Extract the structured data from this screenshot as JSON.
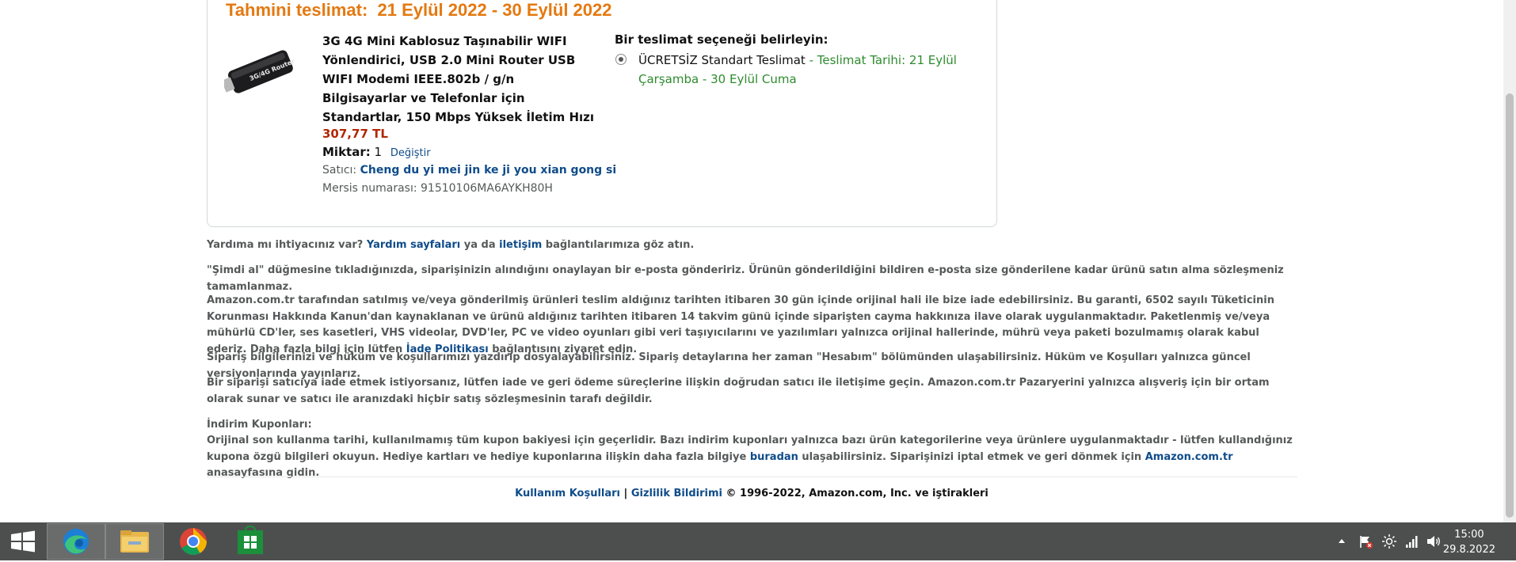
{
  "delivery": {
    "estimate": "Tahmini teslimat:  21 Eylül 2022 - 30 Eylül 2022"
  },
  "product": {
    "image_text": "3G/4G Router",
    "title": "3G 4G Mini Kablosuz Taşınabilir WIFI Yönlendirici, USB 2.0 Mini Router USB WIFI Modemi IEEE.802b / g/n Bilgisayarlar ve Telefonlar için Standartlar, 150 Mbps Yüksek İletim Hızı",
    "price": "307,77 TL",
    "quantity_label": "Miktar:",
    "quantity_value": "1",
    "change_link": "Değiştir",
    "seller_label": "Satıcı:",
    "seller_name": "Cheng du yi mei jin ke ji you xian gong si",
    "mersis": "Mersis numarası: 91510106MA6AYKH80H"
  },
  "shipping_option": {
    "heading": "Bir teslimat seçeneği belirleyin:",
    "option_label": "ÜCRETSİZ Standart Teslimat",
    "option_dates": " - Teslimat Tarihi: 21 Eylül Çarşamba - 30 Eylül Cuma",
    "selected": true
  },
  "info": {
    "help_prefix": "Yardıma mı ihtiyacınız var? ",
    "help_link1": "Yardım sayfaları",
    "help_mid": " ya da ",
    "help_link2": "iletişim",
    "help_suffix": " bağlantılarımıza göz atın.",
    "buy_now": "\"Şimdi al\" düğmesine tıkladığınızda, siparişinizin alındığını onaylayan bir e-posta göndeririz. Ürünün gönderildiğini bildiren e-posta size gönderilene kadar ürünü satın alma sözleşmeniz tamamlanmaz.",
    "returns_text": "Amazon.com.tr tarafından satılmış ve/veya gönderilmiş ürünleri teslim aldığınız tarihten itibaren 30 gün içinde orijinal hali ile bize iade edebilirsiniz. Bu garanti, 6502 sayılı Tüketicinin Korunması Hakkında Kanun'dan kaynaklanan ve ürünü aldığınız tarihten itibaren 14 takvim günü içinde siparişten cayma hakkınıza ilave olarak uygulanmaktadır. Paketlenmiş ve/veya mühürlü CD'ler, ses kasetleri, VHS videolar, DVD'ler, PC ve video oyunları gibi veri taşıyıcılarını ve yazılımları yalnızca orijinal hallerinde, mührü veya paketi bozulmamış olarak kabul ederiz. Daha fazla bilgi için lütfen ",
    "returns_link": "İade Politikası",
    "returns_suffix": " bağlantısını ziyaret edin.",
    "print_info": "Sipariş bilgilerinizi ve hüküm ve koşullarımızı yazdırıp dosyalayabilirsiniz. Sipariş detaylarına her zaman \"Hesabım\" bölümünden ulaşabilirsiniz. Hüküm ve Koşulları yalnızca güncel versiyonlarında yayınlarız.",
    "seller_return": "Bir siparişi satıcıya iade etmek istiyorsanız, lütfen iade ve geri ödeme süreçlerine ilişkin doğrudan satıcı ile iletişime geçin. Amazon.com.tr Pazaryerini yalnızca alışveriş için bir ortam olarak sunar ve satıcı ile aranızdaki hiçbir satış sözleşmesinin tarafı değildir.",
    "coupons_heading": "İndirim Kuponları:",
    "coupons_text": "Orijinal son kullanma tarihi, kullanılmamış tüm kupon bakiyesi için geçerlidir. Bazı indirim kuponları yalnızca bazı ürün kategorilerine veya ürünlere uygulanmaktadır - lütfen kullandığınız kupona özgü bilgileri okuyun. Hediye kartları ve hediye kuponlarına ilişkin daha fazla bilgiye ",
    "coupons_link1": "buradan",
    "coupons_mid": " ulaşabilirsiniz. Siparişinizi iptal etmek ve geri dönmek için ",
    "coupons_link2": "Amazon.com.tr",
    "coupons_suffix": " anasayfasına gidin."
  },
  "footer": {
    "terms": "Kullanım Koşulları",
    "divider": " | ",
    "privacy": "Gizlilik Bildirimi",
    "copyright": " © 1996-2022, Amazon.com, Inc. ve iştirakleri"
  },
  "taskbar": {
    "apps": [
      "edge-icon",
      "file-explorer-icon",
      "chrome-icon",
      "store-icon"
    ],
    "time": "15:00",
    "date": "29.8.2022"
  },
  "colors": {
    "estimate": "#e47911",
    "price": "#b12704",
    "link": "#0f4c8a",
    "delivery_green": "#2e8b2e",
    "taskbar": "#4d4f4f"
  }
}
